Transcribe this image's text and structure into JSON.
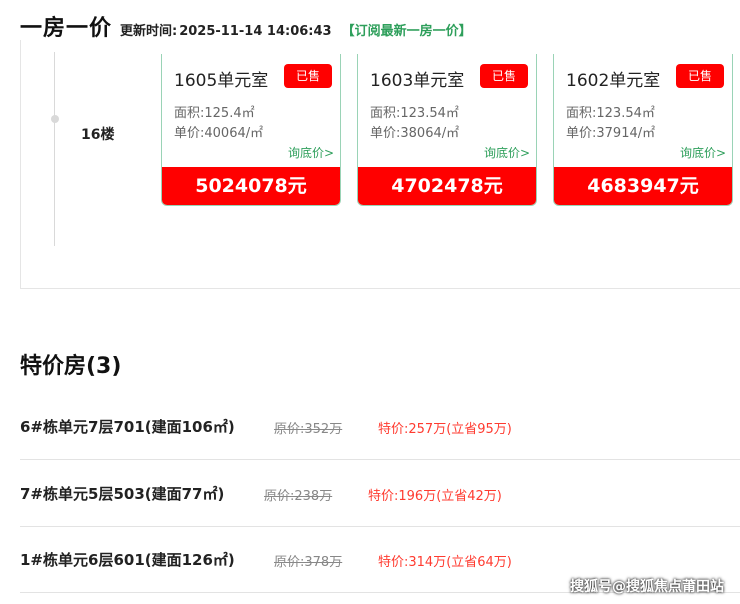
{
  "header": {
    "title": "一房一价",
    "update_label": "更新时间:",
    "update_time": "2025-11-14 14:06:43",
    "subscribe": "【订阅最新一房一价】"
  },
  "floor": {
    "label": "16楼",
    "units": [
      {
        "room": "1605单元室",
        "status": "已售",
        "area": "面积:125.4㎡",
        "unit_price": "单价:40064/㎡",
        "inquiry": "询底价>",
        "total": "5024078元"
      },
      {
        "room": "1603单元室",
        "status": "已售",
        "area": "面积:123.54㎡",
        "unit_price": "单价:38064/㎡",
        "inquiry": "询底价>",
        "total": "4702478元"
      },
      {
        "room": "1602单元室",
        "status": "已售",
        "area": "面积:123.54㎡",
        "unit_price": "单价:37914/㎡",
        "inquiry": "询底价>",
        "total": "4683947元"
      }
    ]
  },
  "special": {
    "title": "特价房(3)",
    "items": [
      {
        "name": "6#栋单元7层701(建面106㎡)",
        "original": "原价:352万",
        "special": "特价:257万(立省95万)"
      },
      {
        "name": "7#栋单元5层503(建面77㎡)",
        "original": "原价:238万",
        "special": "特价:196万(立省42万)"
      },
      {
        "name": "1#栋单元6层601(建面126㎡)",
        "original": "原价:378万",
        "special": "特价:314万(立省64万)"
      }
    ]
  },
  "watermark": "搜狐号@搜狐焦点莆田站",
  "colors": {
    "accent_red": "#ff0000",
    "accent_green": "#2e9f5b",
    "card_border": "#9ad3b6"
  }
}
